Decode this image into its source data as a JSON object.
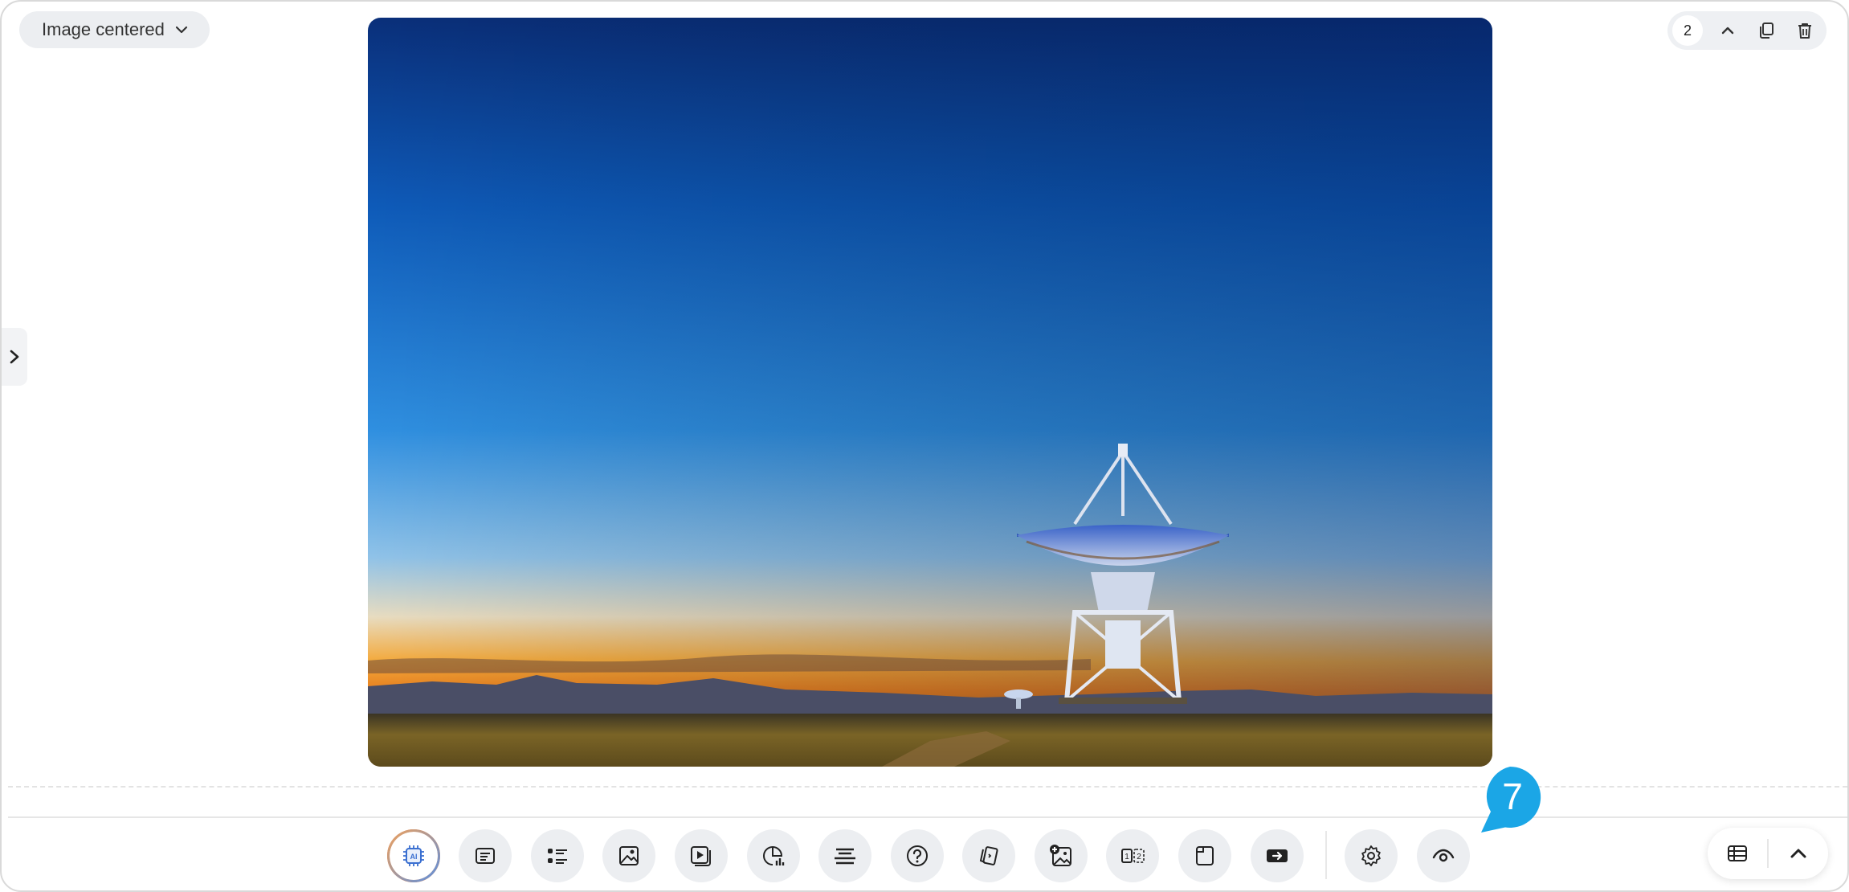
{
  "layout_select": {
    "label": "Image centered"
  },
  "page_controls": {
    "page_number": "2"
  },
  "tour": {
    "step": "7"
  },
  "colors": {
    "accent": "#1ba6e6",
    "ai_border_start": "#f0a15a",
    "ai_border_end": "#5a8fe0"
  },
  "toolbar": {
    "tools": [
      {
        "name": "ai-tool-icon",
        "label": "AI"
      },
      {
        "name": "text-block-icon"
      },
      {
        "name": "list-block-icon"
      },
      {
        "name": "image-block-icon"
      },
      {
        "name": "video-block-icon"
      },
      {
        "name": "chart-block-icon"
      },
      {
        "name": "divider-block-icon"
      },
      {
        "name": "question-block-icon"
      },
      {
        "name": "flashcards-block-icon"
      },
      {
        "name": "add-image-block-icon"
      },
      {
        "name": "numbered-steps-block-icon"
      },
      {
        "name": "page-block-icon"
      },
      {
        "name": "button-block-icon"
      },
      {
        "name": "settings-icon"
      },
      {
        "name": "preview-eye-icon"
      }
    ]
  },
  "hero_image": {
    "subject": "radio-telescope-dish-at-sunset"
  }
}
